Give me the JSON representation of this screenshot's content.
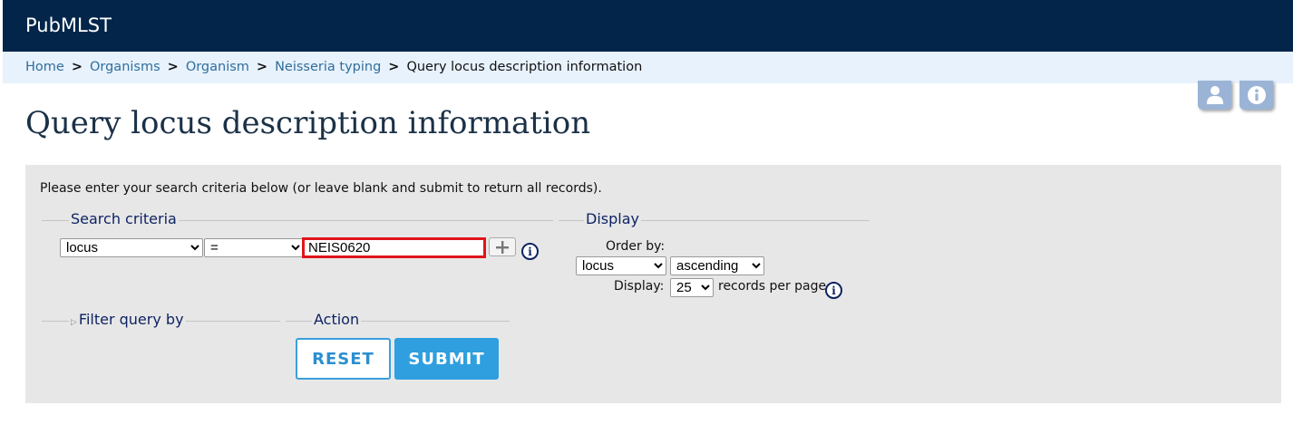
{
  "header": {
    "brand": "PubMLST"
  },
  "breadcrumb": {
    "items": [
      "Home",
      "Organisms",
      "Organism",
      "Neisseria typing"
    ],
    "separator": ">",
    "current": "Query locus description information"
  },
  "corner_icons": [
    "user-icon",
    "info-icon"
  ],
  "page": {
    "title": "Query locus description information"
  },
  "form": {
    "intro": "Please enter your search criteria below (or leave blank and submit to return all records).",
    "search_criteria": {
      "legend": "Search criteria",
      "field": "locus",
      "operator": "=",
      "value": "NEIS0620",
      "add_icon": "plus-icon",
      "help_icon": "info-icon"
    },
    "display": {
      "legend": "Display",
      "order_by_label": "Order by:",
      "order_by_value": "locus",
      "direction_value": "ascending",
      "display_label": "Display:",
      "records_value": "25",
      "records_suffix": "records per page",
      "help_icon": "info-icon"
    },
    "filter": {
      "legend": "Filter query by",
      "collapse_icon": "triangle-right-icon"
    },
    "action": {
      "legend": "Action",
      "reset_label": "RESET",
      "submit_label": "SUBMIT"
    }
  },
  "colors": {
    "header_bg": "#03254a",
    "breadcrumb_bg": "#e8f2fd",
    "panel_bg": "#e7e7e7",
    "highlight": "#e0141b",
    "accent": "#2f9fdf"
  }
}
